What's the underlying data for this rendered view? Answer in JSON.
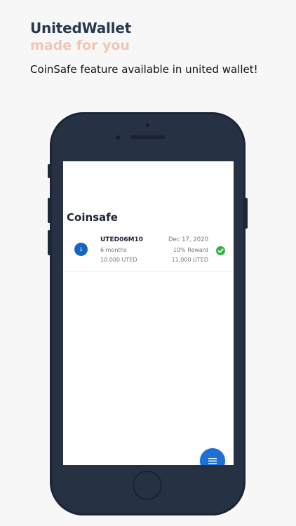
{
  "header": {
    "title": "UnitedWallet",
    "subtitle": "made for you",
    "tagline": "CoinSafe feature available in united wallet!"
  },
  "screen": {
    "title": "Coinsafe",
    "items": [
      {
        "index": "1",
        "code": "UTED06M10",
        "duration": "6 months",
        "amount": "10.000 UTED",
        "date": "Dec 17, 2020",
        "reward": "10% Reward",
        "payout": "11.000 UTED",
        "status_icon": "check-circle-icon"
      }
    ],
    "fab_icon": "menu-icon"
  },
  "colors": {
    "brand_dark": "#28384f",
    "brand_peach": "#f2c6b3",
    "phone_body": "#263244",
    "badge_blue": "#1565c0",
    "fab_blue": "#1e6fd6",
    "success_green": "#34b04a"
  }
}
